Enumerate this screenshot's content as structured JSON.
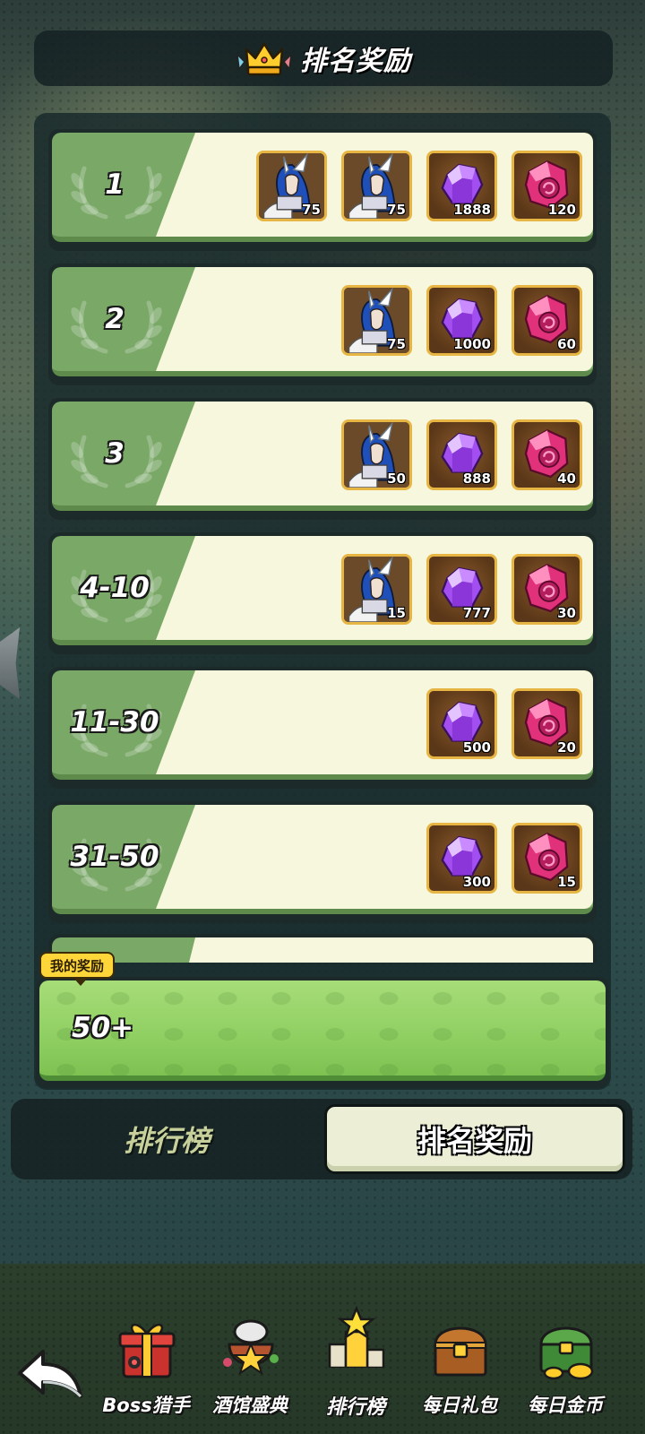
{
  "header": {
    "title": "排名奖励",
    "icon": "crown-icon"
  },
  "rewards": [
    {
      "rank": "1",
      "items": [
        {
          "type": "hero-card",
          "icon": "hero-portrait-icon",
          "count": "75"
        },
        {
          "type": "hero-card",
          "icon": "hero-portrait-icon",
          "count": "75"
        },
        {
          "type": "purple-gem",
          "icon": "purple-gem-icon",
          "count": "1888"
        },
        {
          "type": "pink-crystal",
          "icon": "pink-crystal-icon",
          "count": "120"
        }
      ]
    },
    {
      "rank": "2",
      "items": [
        {
          "type": "hero-card",
          "icon": "hero-portrait-icon",
          "count": "75"
        },
        {
          "type": "purple-gem",
          "icon": "purple-gem-icon",
          "count": "1000"
        },
        {
          "type": "pink-crystal",
          "icon": "pink-crystal-icon",
          "count": "60"
        }
      ]
    },
    {
      "rank": "3",
      "items": [
        {
          "type": "hero-card",
          "icon": "hero-portrait-icon",
          "count": "50"
        },
        {
          "type": "purple-gem",
          "icon": "purple-gem-icon",
          "count": "888"
        },
        {
          "type": "pink-crystal",
          "icon": "pink-crystal-icon",
          "count": "40"
        }
      ]
    },
    {
      "rank": "4-10",
      "items": [
        {
          "type": "hero-card",
          "icon": "hero-portrait-icon",
          "count": "15"
        },
        {
          "type": "purple-gem",
          "icon": "purple-gem-icon",
          "count": "777"
        },
        {
          "type": "pink-crystal",
          "icon": "pink-crystal-icon",
          "count": "30"
        }
      ]
    },
    {
      "rank": "11-30",
      "items": [
        {
          "type": "purple-gem",
          "icon": "purple-gem-icon",
          "count": "500"
        },
        {
          "type": "pink-crystal",
          "icon": "pink-crystal-icon",
          "count": "20"
        }
      ]
    },
    {
      "rank": "31-50",
      "items": [
        {
          "type": "purple-gem",
          "icon": "purple-gem-icon",
          "count": "300"
        },
        {
          "type": "pink-crystal",
          "icon": "pink-crystal-icon",
          "count": "15"
        }
      ]
    }
  ],
  "my_reward": {
    "tag": "我的奖励",
    "rank": "50+"
  },
  "tabs": {
    "leaderboard": "排行榜",
    "rank_rewards": "排名奖励",
    "active": "rank_rewards"
  },
  "bottom_nav": {
    "back_icon": "back-arrow-icon",
    "items": [
      {
        "label": "Boss猎手",
        "icon": "boss-gift-icon"
      },
      {
        "label": "酒馆盛典",
        "icon": "tavern-icon"
      },
      {
        "label": "排行榜",
        "icon": "star-trophy-icon",
        "active": true
      },
      {
        "label": "每日礼包",
        "icon": "treasure-chest-icon"
      },
      {
        "label": "每日金币",
        "icon": "gold-chest-icon"
      }
    ]
  },
  "colors": {
    "row_green": "#7aa867",
    "row_cream": "#f6f7dc",
    "item_border": "#e7b543",
    "my_card_green": "#8fcf62",
    "tag_yellow": "#ffd63a"
  }
}
